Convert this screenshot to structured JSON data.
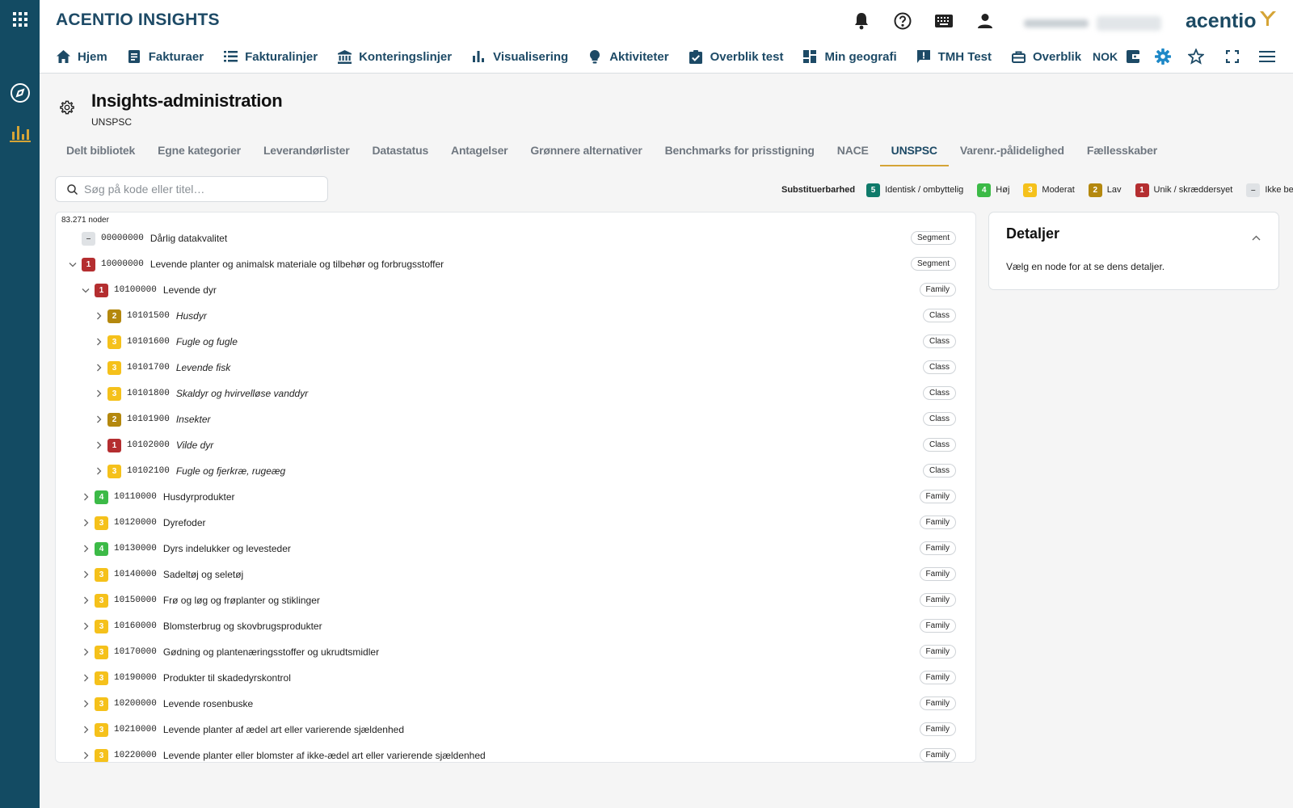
{
  "app": {
    "title": "ACENTIO INSIGHTS",
    "logo_text": "acentio"
  },
  "rail": {
    "icons": [
      "apps-icon",
      "compass-icon",
      "bar-chart-icon"
    ]
  },
  "header": {
    "icons": [
      "bell-icon",
      "help-icon",
      "keyboard-icon",
      "user-icon"
    ],
    "nav": [
      {
        "label": "Hjem",
        "icon": "home-icon"
      },
      {
        "label": "Fakturaer",
        "icon": "document-icon"
      },
      {
        "label": "Fakturalinjer",
        "icon": "list-icon"
      },
      {
        "label": "Konteringslinjer",
        "icon": "bank-icon"
      },
      {
        "label": "Visualisering",
        "icon": "bar-chart-icon"
      },
      {
        "label": "Aktiviteter",
        "icon": "lightbulb-icon"
      },
      {
        "label": "Overblik test",
        "icon": "clipboard-check-icon"
      },
      {
        "label": "Min geografi",
        "icon": "dashboard-icon"
      },
      {
        "label": "TMH Test",
        "icon": "feedback-icon"
      },
      {
        "label": "Overblik",
        "icon": "toolbox-icon"
      }
    ],
    "currency": "NOK",
    "right_icons": [
      "wallet-icon",
      "gear-icon",
      "star-icon",
      "fullscreen-icon",
      "menu-icon"
    ]
  },
  "page": {
    "title": "Insights-administration",
    "subtitle": "UNSPSC"
  },
  "tabs": [
    {
      "label": "Delt bibliotek",
      "active": false
    },
    {
      "label": "Egne kategorier",
      "active": false
    },
    {
      "label": "Leverandørlister",
      "active": false
    },
    {
      "label": "Datastatus",
      "active": false
    },
    {
      "label": "Antagelser",
      "active": false
    },
    {
      "label": "Grønnere alternativer",
      "active": false
    },
    {
      "label": "Benchmarks for prisstigning",
      "active": false
    },
    {
      "label": "NACE",
      "active": false
    },
    {
      "label": "UNSPSC",
      "active": true
    },
    {
      "label": "Varenr.-pålidelighed",
      "active": false
    },
    {
      "label": "Fællesskaber",
      "active": false
    }
  ],
  "search": {
    "placeholder": "Søg på kode eller titel…",
    "value": ""
  },
  "legend": {
    "label": "Substituerbarhed",
    "items": [
      {
        "level": "5",
        "label": "Identisk / ombyttelig",
        "color": "#0f7a6a"
      },
      {
        "level": "4",
        "label": "Høj",
        "color": "#3cba47"
      },
      {
        "level": "3",
        "label": "Moderat",
        "color": "#f5c11b"
      },
      {
        "level": "2",
        "label": "Lav",
        "color": "#b4880e"
      },
      {
        "level": "1",
        "label": "Unik / skræddersyet",
        "color": "#b42e30"
      },
      {
        "level": "–",
        "label": "Ikke bedømt",
        "color": "#dfe2e5"
      }
    ]
  },
  "tree": {
    "count": "83.271 noder",
    "rows": [
      {
        "depth": 0,
        "chev": "none",
        "badge": "–",
        "code": "00000000",
        "title": "Dårlig datakvalitet",
        "italic": false,
        "type": "Segment"
      },
      {
        "depth": 0,
        "chev": "down",
        "badge": "1",
        "code": "10000000",
        "title": "Levende planter og animalsk materiale og tilbehør og forbrugsstoffer",
        "italic": false,
        "type": "Segment"
      },
      {
        "depth": 1,
        "chev": "down",
        "badge": "1",
        "code": "10100000",
        "title": "Levende dyr",
        "italic": false,
        "type": "Family"
      },
      {
        "depth": 2,
        "chev": "right",
        "badge": "2",
        "code": "10101500",
        "title": "Husdyr",
        "italic": true,
        "type": "Class"
      },
      {
        "depth": 2,
        "chev": "right",
        "badge": "3",
        "code": "10101600",
        "title": "Fugle og fugle",
        "italic": true,
        "type": "Class"
      },
      {
        "depth": 2,
        "chev": "right",
        "badge": "3",
        "code": "10101700",
        "title": "Levende fisk",
        "italic": true,
        "type": "Class"
      },
      {
        "depth": 2,
        "chev": "right",
        "badge": "3",
        "code": "10101800",
        "title": "Skaldyr og hvirvelløse vanddyr",
        "italic": true,
        "type": "Class"
      },
      {
        "depth": 2,
        "chev": "right",
        "badge": "2",
        "code": "10101900",
        "title": "Insekter",
        "italic": true,
        "type": "Class"
      },
      {
        "depth": 2,
        "chev": "right",
        "badge": "1",
        "code": "10102000",
        "title": "Vilde dyr",
        "italic": true,
        "type": "Class"
      },
      {
        "depth": 2,
        "chev": "right",
        "badge": "3",
        "code": "10102100",
        "title": "Fugle og fjerkræ, rugeæg",
        "italic": true,
        "type": "Class"
      },
      {
        "depth": 1,
        "chev": "right",
        "badge": "4",
        "code": "10110000",
        "title": "Husdyrprodukter",
        "italic": false,
        "type": "Family"
      },
      {
        "depth": 1,
        "chev": "right",
        "badge": "3",
        "code": "10120000",
        "title": "Dyrefoder",
        "italic": false,
        "type": "Family"
      },
      {
        "depth": 1,
        "chev": "right",
        "badge": "4",
        "code": "10130000",
        "title": "Dyrs indelukker og levesteder",
        "italic": false,
        "type": "Family"
      },
      {
        "depth": 1,
        "chev": "right",
        "badge": "3",
        "code": "10140000",
        "title": "Sadeltøj og seletøj",
        "italic": false,
        "type": "Family"
      },
      {
        "depth": 1,
        "chev": "right",
        "badge": "3",
        "code": "10150000",
        "title": "Frø og løg og frøplanter og stiklinger",
        "italic": false,
        "type": "Family"
      },
      {
        "depth": 1,
        "chev": "right",
        "badge": "3",
        "code": "10160000",
        "title": "Blomsterbrug og skovbrugsprodukter",
        "italic": false,
        "type": "Family"
      },
      {
        "depth": 1,
        "chev": "right",
        "badge": "3",
        "code": "10170000",
        "title": "Gødning og plantenæringsstoffer og ukrudtsmidler",
        "italic": false,
        "type": "Family"
      },
      {
        "depth": 1,
        "chev": "right",
        "badge": "3",
        "code": "10190000",
        "title": "Produkter til skadedyrskontrol",
        "italic": false,
        "type": "Family"
      },
      {
        "depth": 1,
        "chev": "right",
        "badge": "3",
        "code": "10200000",
        "title": "Levende rosenbuske",
        "italic": false,
        "type": "Family"
      },
      {
        "depth": 1,
        "chev": "right",
        "badge": "3",
        "code": "10210000",
        "title": "Levende planter af ædel art eller varierende sjældenhed",
        "italic": false,
        "type": "Family"
      },
      {
        "depth": 1,
        "chev": "right",
        "badge": "3",
        "code": "10220000",
        "title": "Levende planter eller blomster af ikke-ædel art eller varierende sjældenhed",
        "italic": false,
        "type": "Family"
      }
    ]
  },
  "details": {
    "title": "Detaljer",
    "message": "Vælg en node for at se dens detaljer."
  }
}
